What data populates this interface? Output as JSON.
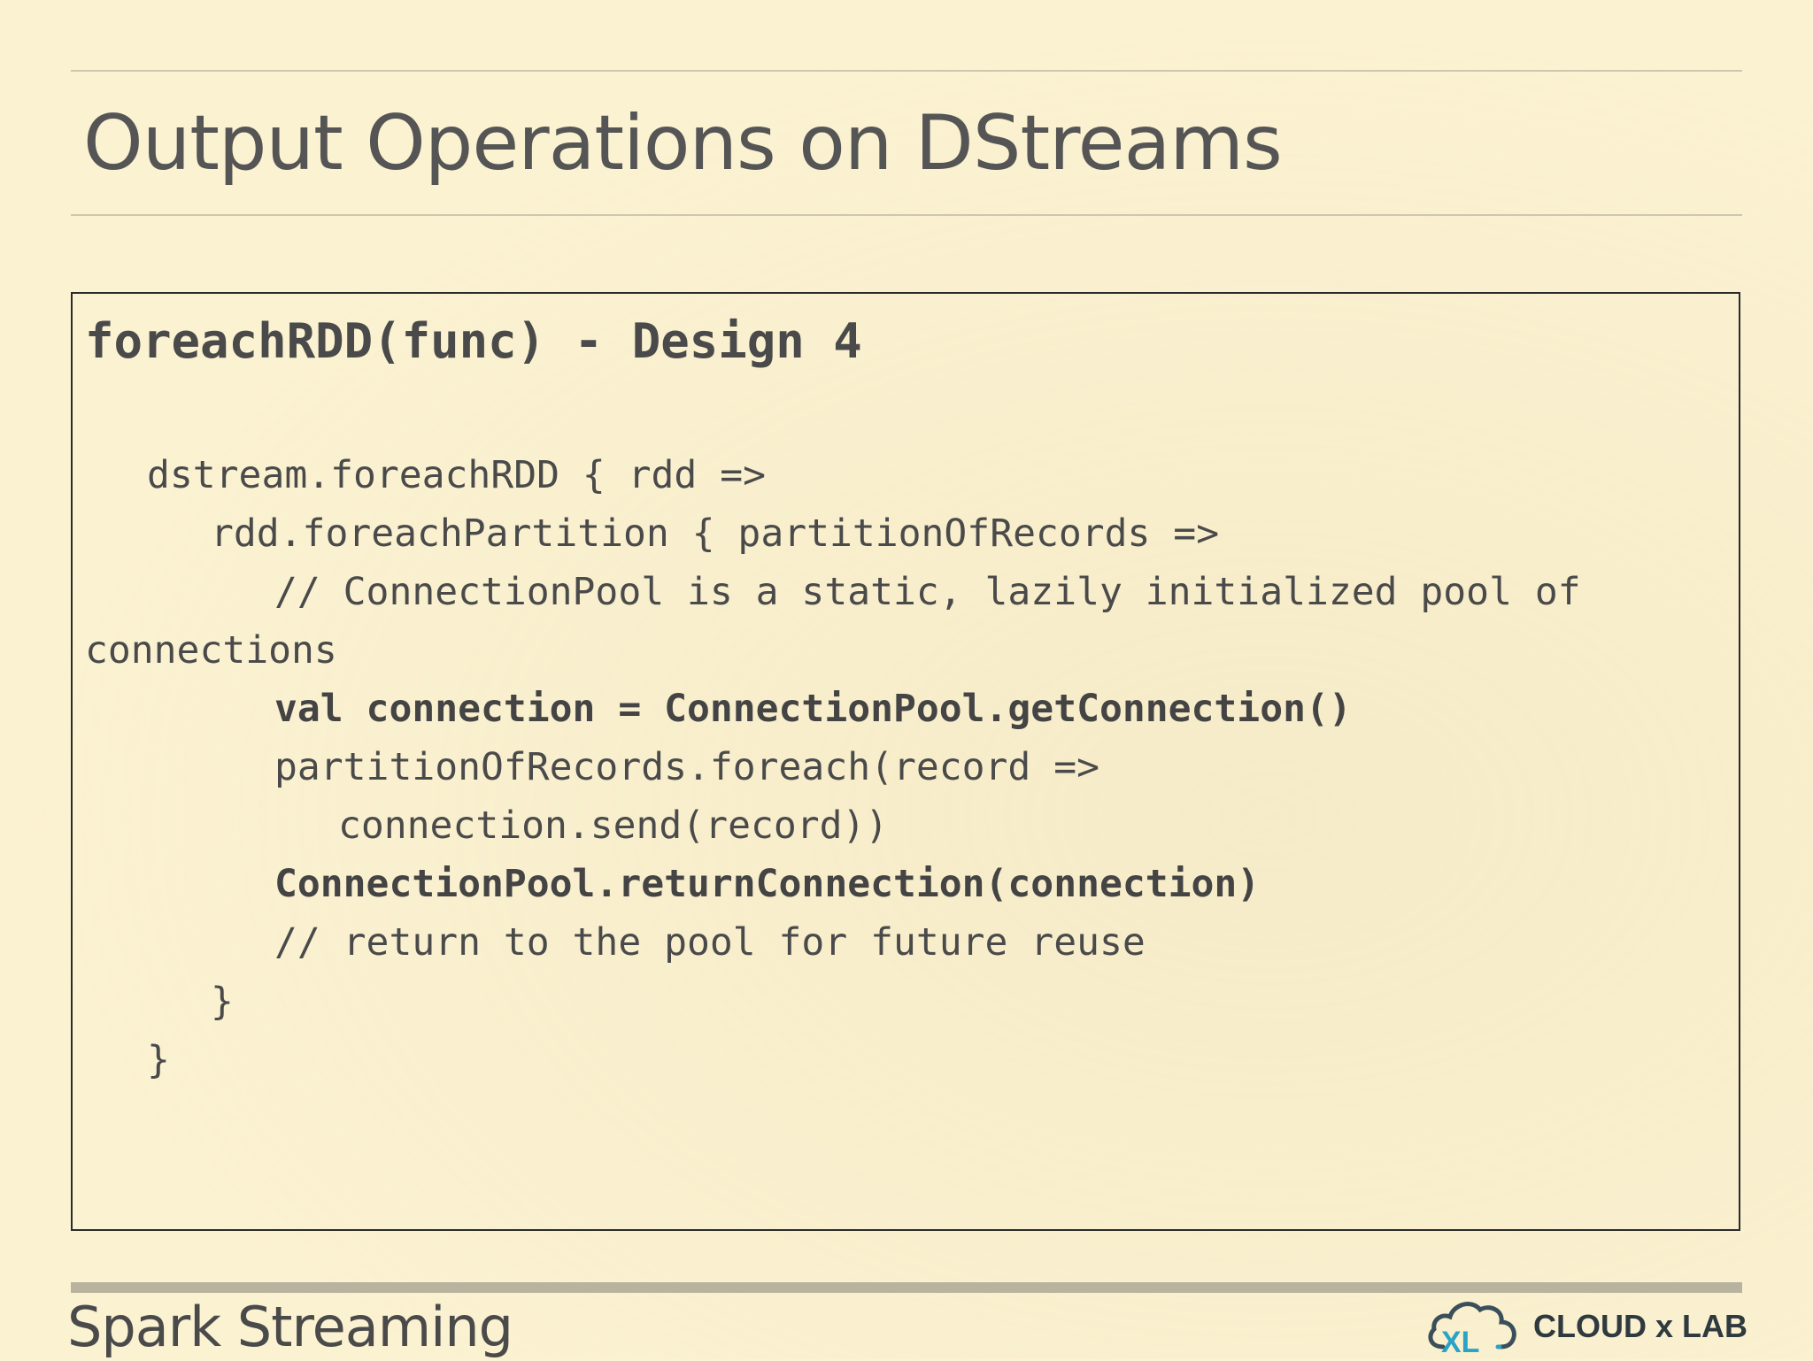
{
  "slide": {
    "title": "Output Operations on DStreams",
    "footer_title": "Spark Streaming"
  },
  "code_box": {
    "heading": "foreachRDD(func) - Design 4",
    "lines": [
      {
        "text": "dstream.foreachRDD { rdd =>",
        "bold": false
      },
      {
        "text": "rdd.foreachPartition { partitionOfRecords =>",
        "bold": false
      },
      {
        "text": "// ConnectionPool is a static, lazily initialized pool of",
        "bold": false
      },
      {
        "text": "connections",
        "bold": false
      },
      {
        "text": "val connection = ConnectionPool.getConnection()",
        "bold": true
      },
      {
        "text": "partitionOfRecords.foreach(record =>",
        "bold": false
      },
      {
        "text": "connection.send(record))",
        "bold": false
      },
      {
        "text": "ConnectionPool.returnConnection(connection)",
        "bold": true
      },
      {
        "text": "// return to the pool for future reuse",
        "bold": false
      },
      {
        "text": "}",
        "bold": false
      },
      {
        "text": "}",
        "bold": false
      }
    ]
  },
  "logo": {
    "text": "CLOUD x LAB",
    "mark_text": "XL",
    "icon": "cloud-icon",
    "colors": {
      "cloud": "#3b4f5a",
      "accent": "#2aa3c6"
    }
  }
}
